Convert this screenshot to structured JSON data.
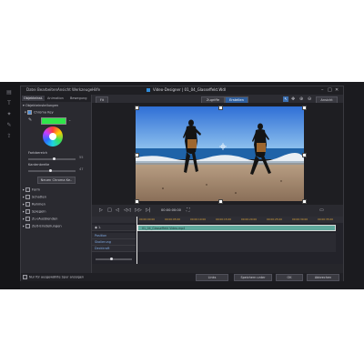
{
  "app": {
    "title": "Video-Designer | 01_04_Glasseffekt.Wdl",
    "menu": [
      "Datei",
      "Bearbeiten",
      "Ansicht",
      "Werkzeuge",
      "Hilfe"
    ],
    "window_controls": [
      "–",
      "□",
      "✕"
    ]
  },
  "left_strip_icons": [
    "layers-icon",
    "text-icon",
    "fx-icon",
    "brush-icon",
    "export-icon"
  ],
  "panel": {
    "tabs": [
      "Objekteinst.",
      "Animation",
      "Bewegung"
    ],
    "section_chroma_settings": "Objekteinstellungen",
    "chroma_key_label": "Chroma Key",
    "chroma_key_enabled": true,
    "key_color": "#2fe54a",
    "slider_color_range_label": "Farbbereich",
    "slider_color_range_value": "55",
    "color_range_level": 0.55,
    "slider_denoise_label": "Kantenbreite",
    "slider_denoise_value": "47",
    "denoise_level": 0.47,
    "add_key_button": "Neuen Chroma Ke..",
    "sections": [
      "Form",
      "Schatten",
      "Rahmen",
      "Spiegeln",
      "Zu-/Ausblenden",
      "Zeit-Einstellungen"
    ],
    "footer_checkbox": "Nur für ausgewählte Spur anzeigen"
  },
  "preview_toolbar": {
    "fit_label": "Fit",
    "mode_tabs": [
      "Zugriffe",
      "Erstellen"
    ],
    "right_label": "Ansicht"
  },
  "player": {
    "controls": [
      "play",
      "stop",
      "prev",
      "rewind",
      "forward",
      "next"
    ],
    "timecode": "00:00:00:00"
  },
  "timeline": {
    "ruler": [
      "00:00:00:00",
      "00:00:05:00",
      "00:00:10:00",
      "00:00:15:00",
      "00:00:20:00",
      "00:00:25:00",
      "00:00:30:00",
      "00:00:35:00"
    ],
    "tracks": [
      "1.",
      "Position",
      "Skalierung",
      "Deckkraft"
    ],
    "clip_label": "01_04_Glasseffekt Video.mp4",
    "clip_color": "#5fa89c"
  },
  "footer": {
    "buttons": [
      "Links",
      "Speichern unter",
      "OK",
      "Abbrechen"
    ]
  }
}
